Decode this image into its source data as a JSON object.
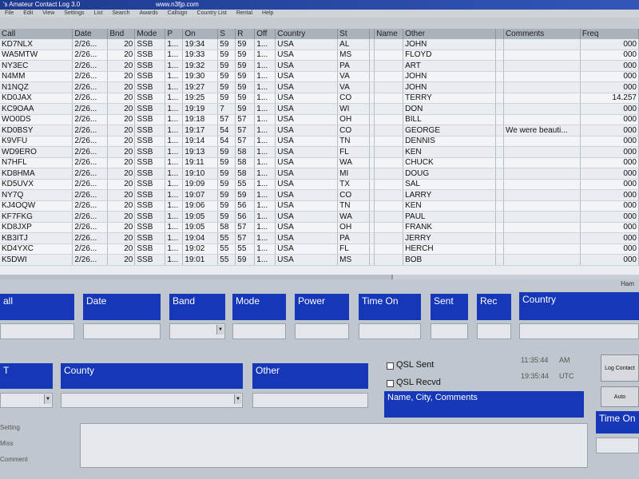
{
  "window": {
    "title": "'s Amateur Contact Log 3.0",
    "url": "www.n3fjp.com"
  },
  "menu": [
    "File",
    "Edit",
    "View",
    "Settings",
    "List",
    "Search",
    "Awards",
    "Callsign",
    "Country List",
    "Rental",
    "Help"
  ],
  "columns": [
    "Call",
    "Date",
    "Bnd",
    "Mode",
    "P",
    "On",
    "S",
    "R",
    "Off",
    "Country",
    "St",
    "",
    "Name",
    "Other",
    "",
    "Comments",
    "Freq"
  ],
  "rows": [
    [
      "KD7NLX",
      "2/26...",
      "20",
      "SSB",
      "1...",
      "19:34",
      "59",
      "59",
      "1...",
      "USA",
      "AL",
      "",
      "",
      "JOHN",
      "",
      "",
      "000"
    ],
    [
      "WA5MTW",
      "2/26...",
      "20",
      "SSB",
      "1...",
      "19:33",
      "59",
      "59",
      "1...",
      "USA",
      "MS",
      "",
      "",
      "FLOYD",
      "",
      "",
      "000"
    ],
    [
      "NY3EC",
      "2/26...",
      "20",
      "SSB",
      "1...",
      "19:32",
      "59",
      "59",
      "1...",
      "USA",
      "PA",
      "",
      "",
      "ART",
      "",
      "",
      "000"
    ],
    [
      "N4MM",
      "2/26...",
      "20",
      "SSB",
      "1...",
      "19:30",
      "59",
      "59",
      "1...",
      "USA",
      "VA",
      "",
      "",
      "JOHN",
      "",
      "",
      "000"
    ],
    [
      "N1NQZ",
      "2/26...",
      "20",
      "SSB",
      "1...",
      "19:27",
      "59",
      "59",
      "1...",
      "USA",
      "VA",
      "",
      "",
      "JOHN",
      "",
      "",
      "000"
    ],
    [
      "KD0JAX",
      "2/26...",
      "20",
      "SSB",
      "1...",
      "19:25",
      "59",
      "59",
      "1...",
      "USA",
      "CO",
      "",
      "",
      "TERRY",
      "",
      "",
      "14.257"
    ],
    [
      "KC9OAA",
      "2/26...",
      "20",
      "SSB",
      "1...",
      "19:19",
      "7",
      "59",
      "1...",
      "USA",
      "WI",
      "",
      "",
      "DON",
      "",
      "",
      "000"
    ],
    [
      "WO0DS",
      "2/26...",
      "20",
      "SSB",
      "1...",
      "19:18",
      "57",
      "57",
      "1...",
      "USA",
      "OH",
      "",
      "",
      "BILL",
      "",
      "",
      "000"
    ],
    [
      "KD0BSY",
      "2/26...",
      "20",
      "SSB",
      "1...",
      "19:17",
      "54",
      "57",
      "1...",
      "USA",
      "CO",
      "",
      "",
      "GEORGE",
      "",
      "We were beauti...",
      "000"
    ],
    [
      "K9VFU",
      "2/26...",
      "20",
      "SSB",
      "1...",
      "19:14",
      "54",
      "57",
      "1...",
      "USA",
      "TN",
      "",
      "",
      "DENNIS",
      "",
      "",
      "000"
    ],
    [
      "WD9ERO",
      "2/26...",
      "20",
      "SSB",
      "1...",
      "19:13",
      "59",
      "58",
      "1...",
      "USA",
      "FL",
      "",
      "",
      "KEN",
      "",
      "",
      "000"
    ],
    [
      "N7HFL",
      "2/26...",
      "20",
      "SSB",
      "1...",
      "19:11",
      "59",
      "58",
      "1...",
      "USA",
      "WA",
      "",
      "",
      "CHUCK",
      "",
      "",
      "000"
    ],
    [
      "KD8HMA",
      "2/26...",
      "20",
      "SSB",
      "1...",
      "19:10",
      "59",
      "58",
      "1...",
      "USA",
      "MI",
      "",
      "",
      "DOUG",
      "",
      "",
      "000"
    ],
    [
      "KD5UVX",
      "2/26...",
      "20",
      "SSB",
      "1...",
      "19:09",
      "59",
      "55",
      "1...",
      "USA",
      "TX",
      "",
      "",
      "SAL",
      "",
      "",
      "000"
    ],
    [
      "NY7Q",
      "2/26...",
      "20",
      "SSB",
      "1...",
      "19:07",
      "59",
      "59",
      "1...",
      "USA",
      "CO",
      "",
      "",
      "LARRY",
      "",
      "",
      "000"
    ],
    [
      "KJ4OQW",
      "2/26...",
      "20",
      "SSB",
      "1...",
      "19:06",
      "59",
      "56",
      "1...",
      "USA",
      "TN",
      "",
      "",
      "KEN",
      "",
      "",
      "000"
    ],
    [
      "KF7FKG",
      "2/26...",
      "20",
      "SSB",
      "1...",
      "19:05",
      "59",
      "56",
      "1...",
      "USA",
      "WA",
      "",
      "",
      "PAUL",
      "",
      "",
      "000"
    ],
    [
      "KD8JXP",
      "2/26...",
      "20",
      "SSB",
      "1...",
      "19:05",
      "58",
      "57",
      "1...",
      "USA",
      "OH",
      "",
      "",
      "FRANK",
      "",
      "",
      "000"
    ],
    [
      "KB3ITJ",
      "2/26...",
      "20",
      "SSB",
      "1...",
      "19:04",
      "55",
      "57",
      "1...",
      "USA",
      "PA",
      "",
      "",
      "JERRY",
      "",
      "",
      "000"
    ],
    [
      "KD4YXC",
      "2/26...",
      "20",
      "SSB",
      "1...",
      "19:02",
      "55",
      "55",
      "1...",
      "USA",
      "FL",
      "",
      "",
      "HERCH",
      "",
      "",
      "000"
    ],
    [
      "K5DWI",
      "2/26...",
      "20",
      "SSB",
      "1...",
      "19:01",
      "55",
      "59",
      "1...",
      "USA",
      "MS",
      "",
      "",
      "BOB",
      "",
      "",
      "000"
    ]
  ],
  "status": {
    "right": "Ham"
  },
  "entry_labels": {
    "call": "all",
    "date": "Date",
    "band": "Band",
    "mode": "Mode",
    "power": "Power",
    "time_on": "Time On",
    "sent": "Sent",
    "rec": "Rec",
    "country": "Country",
    "state": "T",
    "county": "County",
    "other": "Other",
    "name_city_comments": "Name, City, Comments",
    "time_on2": "Time On"
  },
  "qsl": {
    "sent": "QSL Sent",
    "recvd": "QSL Recvd"
  },
  "clock": {
    "local": "11:35:44",
    "local_suffix": "AM",
    "utc": "19:35:44",
    "utc_suffix": "UTC"
  },
  "buttons": {
    "log_contact": "Log Contact",
    "auto": "Auto"
  },
  "side_labels": [
    "Setting",
    "Miss",
    "Comment"
  ],
  "colors": {
    "accent": "#1537b8",
    "grid_bg": "#e9edf2"
  }
}
